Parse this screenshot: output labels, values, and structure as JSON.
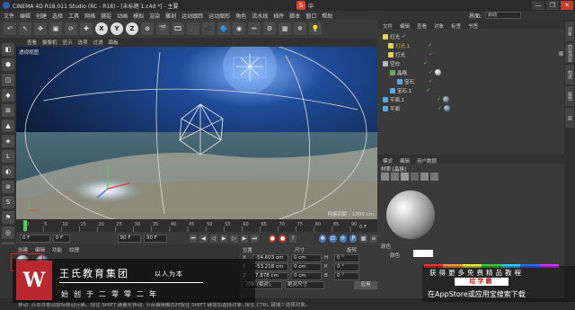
{
  "window": {
    "title": "CINEMA 4D R18.011 Studio (RC - R18) - [未标题 1.c4d *] - 主要",
    "ime_label": "中",
    "controls": [
      "—",
      "❐",
      "✕"
    ]
  },
  "menu": {
    "items": [
      "文件",
      "编辑",
      "创建",
      "选择",
      "工具",
      "网格",
      "捕捉",
      "动画",
      "模拟",
      "渲染",
      "雕刻",
      "运动跟踪",
      "运动图形",
      "角色",
      "流水线",
      "插件",
      "脚本",
      "窗口",
      "帮助"
    ],
    "layout_label": "界面:",
    "layout_value": "启动"
  },
  "toolbar": {
    "buttons": [
      "↶",
      "↖",
      "✥",
      "▣",
      "⟳",
      "✚",
      "X",
      "Y",
      "Z",
      "⊕",
      "🎬",
      "🎞",
      "🎥",
      "⬛",
      "🔷",
      "◉",
      "✏",
      "⚙",
      "▦",
      "❄",
      "💡"
    ]
  },
  "left_tools": [
    "◧",
    "⬢",
    "◫",
    "◆",
    "⊞",
    "▲",
    "◈",
    "L",
    "◐",
    "⊚",
    "S",
    "⚑",
    "◎",
    "⚒",
    "⬛"
  ],
  "viewport": {
    "menu": [
      "查看",
      "摄像机",
      "显示",
      "选项",
      "过滤",
      "面板"
    ],
    "label": "透视视图",
    "status": "网格间距 : 1000 cm"
  },
  "timeline": {
    "ticks": [
      "0",
      "5",
      "10",
      "15",
      "20",
      "25",
      "30",
      "35",
      "40",
      "45",
      "50",
      "55",
      "60",
      "65",
      "70",
      "75",
      "80",
      "85",
      "90"
    ],
    "end_label": "0 F"
  },
  "frames": {
    "start": "0 F",
    "current": "0 F",
    "end": "90 F",
    "max": "90 F"
  },
  "coords": {
    "headers": [
      "位置",
      "尺寸",
      "旋转"
    ],
    "rows": [
      {
        "axis": "X",
        "pos": "-54.603 cm",
        "size": "0 cm",
        "rot_label": "H",
        "rot": "0 °"
      },
      {
        "axis": "Y",
        "pos": "-53.218 cm",
        "size": "0 cm",
        "rot_label": "P",
        "rot": "0 °"
      },
      {
        "axis": "Z",
        "pos": "7.878 cm",
        "size": "0 cm",
        "rot_label": "B",
        "rot": "0 °"
      }
    ],
    "mode1": "对象 (相对)",
    "mode2": "绝对尺寸",
    "apply": "应用"
  },
  "material_panel": {
    "tabs": [
      "创建",
      "编辑",
      "功能",
      "纹理"
    ]
  },
  "objects": {
    "tabs": [
      "文件",
      "编辑",
      "查看",
      "对象",
      "标签",
      "书签"
    ],
    "items": [
      {
        "name": "灯光",
        "selected": false,
        "indent": 0
      },
      {
        "name": "灯光.1",
        "selected": true,
        "indent": 1
      },
      {
        "name": "灯光",
        "selected": false,
        "indent": 1
      },
      {
        "name": "空白",
        "selected": false,
        "indent": 0
      },
      {
        "name": "晶格",
        "selected": false,
        "indent": 1
      },
      {
        "name": "宝石",
        "selected": false,
        "indent": 2
      },
      {
        "name": "宝石.1",
        "selected": false,
        "indent": 1
      },
      {
        "name": "平面.1",
        "selected": false,
        "indent": 0
      },
      {
        "name": "平面",
        "selected": false,
        "indent": 0
      }
    ]
  },
  "attributes": {
    "tabs": [
      "模式",
      "编辑",
      "用户数据"
    ],
    "material_name": "材质 [晶格]",
    "section": "颜色",
    "color_label": "颜色"
  },
  "side_tabs": [
    "对象",
    "内容浏览器",
    "构造",
    "属性",
    "层"
  ],
  "statusbar": "移动: 点击并拖动鼠标移动元素。按住 SHIFT 键量化移动; 节点编辑模式时按住 SHIFT 键增加选择对象; 按住 CTRL 键减少选择对象。",
  "ad_left": {
    "logo": "W",
    "brand": "王氏教育集团",
    "slogan": "以人为本",
    "since": "始创于二零零二年"
  },
  "ad_right": {
    "line1": "获得更多免费精品教程",
    "badge": "绘学霸",
    "line3": "在AppStore或应用宝搜索下载"
  },
  "colors": {
    "accent": "#4a77b8",
    "selected": "#e6b33c",
    "ad_red": "#b8282f"
  }
}
